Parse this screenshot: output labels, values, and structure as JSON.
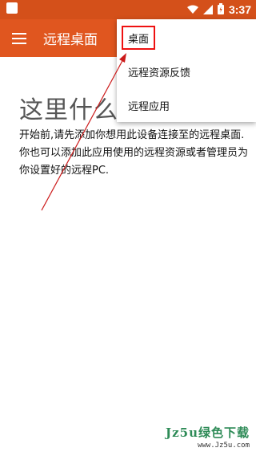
{
  "status_bar": {
    "time": "3:37",
    "icons": [
      "wifi-icon",
      "signal-icon",
      "battery-icon"
    ]
  },
  "app_bar": {
    "title": "远程桌面",
    "menu_icon": "hamburger-menu-icon"
  },
  "content": {
    "heading": "这里什么",
    "description": "开始前,请先添加你想用此设备连接至的远程桌面.你也可以添加此应用使用的远程资源或者管理员为你设置好的远程PC."
  },
  "dropdown_menu": {
    "items": [
      {
        "label": "桌面"
      },
      {
        "label": "远程资源反馈"
      },
      {
        "label": "远程应用"
      }
    ]
  },
  "watermark": {
    "main": "Jz5u绿色下载",
    "url": "www.Jz5u.com"
  },
  "colors": {
    "status_bar": "#d4501a",
    "app_bar": "#e0561f",
    "highlight": "#ee1111",
    "watermark": "#2e8b57"
  }
}
